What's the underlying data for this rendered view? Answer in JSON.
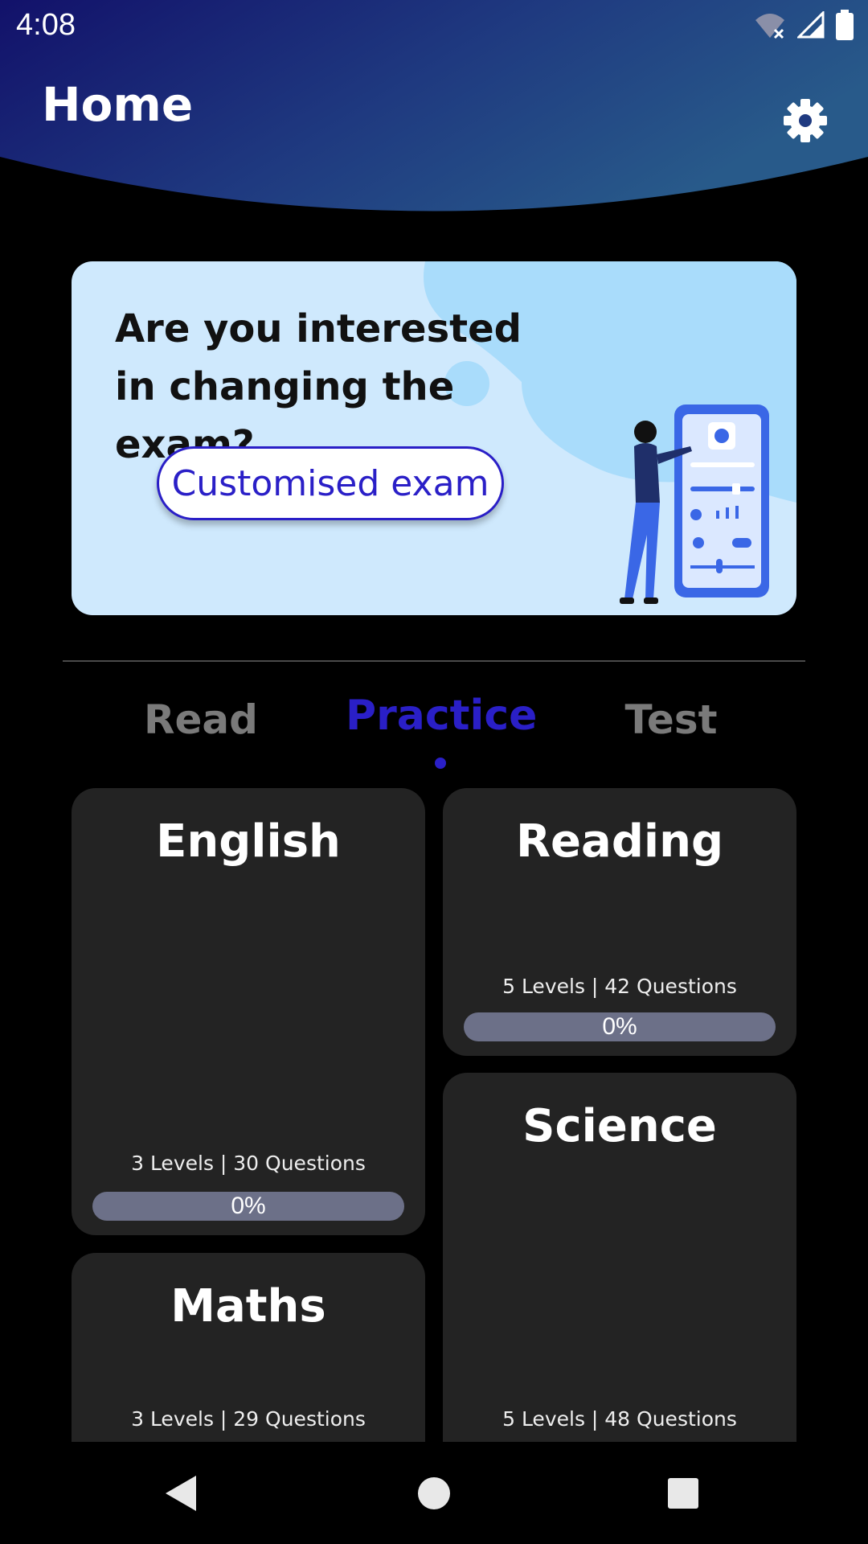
{
  "status_bar": {
    "time": "4:08",
    "icons": [
      "wifi-off-icon",
      "signal-icon",
      "battery-icon"
    ]
  },
  "header": {
    "title": "Home",
    "settings_icon": "gear-icon",
    "gradient_colors": [
      "#12116a",
      "#1f3a80",
      "#285a8a"
    ]
  },
  "banner": {
    "title": "Are you interested in changing the exam?",
    "button_label": "Customised exam",
    "background_color": "#cfe9fd",
    "accent_color": "#2a1fc7"
  },
  "tabs": [
    {
      "label": "Read",
      "active": false
    },
    {
      "label": "Practice",
      "active": true
    },
    {
      "label": "Test",
      "active": false
    }
  ],
  "subjects": [
    {
      "name": "English",
      "meta": "3 Levels | 30 Questions",
      "progress_label": "0%",
      "progress": 0
    },
    {
      "name": "Reading",
      "meta": "5 Levels | 42 Questions",
      "progress_label": "0%",
      "progress": 0
    },
    {
      "name": "Science",
      "meta": "5 Levels | 48 Questions",
      "progress_label": "",
      "progress": 0
    },
    {
      "name": "Maths",
      "meta": "3 Levels | 29 Questions",
      "progress_label": "",
      "progress": 0
    }
  ],
  "nav_bar": {
    "back_icon": "back-triangle-icon",
    "home_icon": "home-circle-icon",
    "recents_icon": "recents-square-icon"
  }
}
